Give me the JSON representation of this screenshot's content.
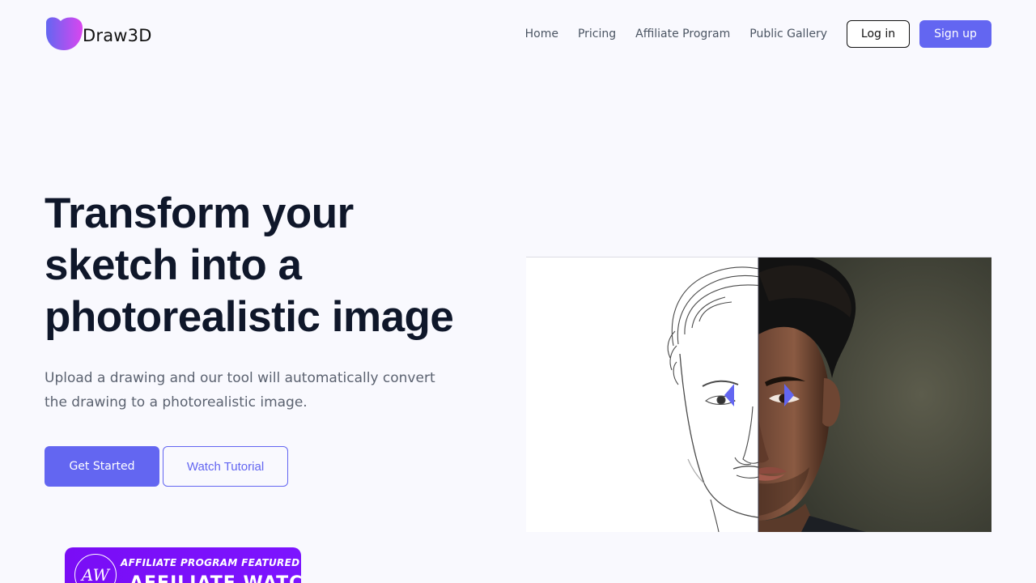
{
  "header": {
    "brand_name": "Draw3D",
    "nav": [
      "Home",
      "Pricing",
      "Affiliate Program",
      "Public Gallery"
    ],
    "login_label": "Log in",
    "signup_label": "Sign up"
  },
  "hero": {
    "title": "Transform your sketch into a photorealistic image",
    "subtitle": "Upload a drawing and our tool will automatically convert the drawing to a photorealistic image.",
    "primary_cta": "Get Started",
    "secondary_cta": "Watch Tutorial"
  },
  "badge": {
    "line1": "AFFILIATE PROGRAM FEATURED ON",
    "line2": "AFFILIATE WATCH",
    "monogram": "AW"
  },
  "comparison": {
    "slider_position": 0.5,
    "left_label_icon": "sketch-image",
    "right_label_icon": "photo-image"
  },
  "colors": {
    "accent": "#6366f1",
    "background": "#f9f9fe",
    "heading": "#0f172a",
    "badge": "#7a0df5"
  }
}
